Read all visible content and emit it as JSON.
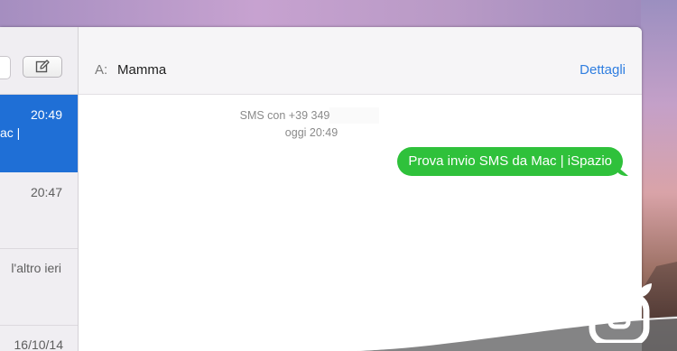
{
  "sidebar": {
    "conversations": [
      {
        "time": "20:49",
        "snippet": "ac |",
        "active": true
      },
      {
        "time": "20:47",
        "snippet": "",
        "active": false
      },
      {
        "time": "l'altro ieri",
        "snippet": "",
        "active": false
      },
      {
        "time": "16/10/14",
        "snippet": "",
        "active": false
      }
    ]
  },
  "header": {
    "to_label": "A:",
    "recipient": "Mamma",
    "details_label": "Dettagli"
  },
  "chat": {
    "sms_info": "SMS con +39 349",
    "timestamp": "oggi 20:49",
    "messages": [
      {
        "text": "Prova invio SMS da Mac | iSpazio",
        "direction": "outgoing"
      }
    ]
  },
  "colors": {
    "accent": "#1f6fd6",
    "bubble": "#2fc13b",
    "link": "#2f7ee0"
  },
  "icons": {
    "compose": "compose-icon",
    "watermark": "ispazio-logo"
  }
}
